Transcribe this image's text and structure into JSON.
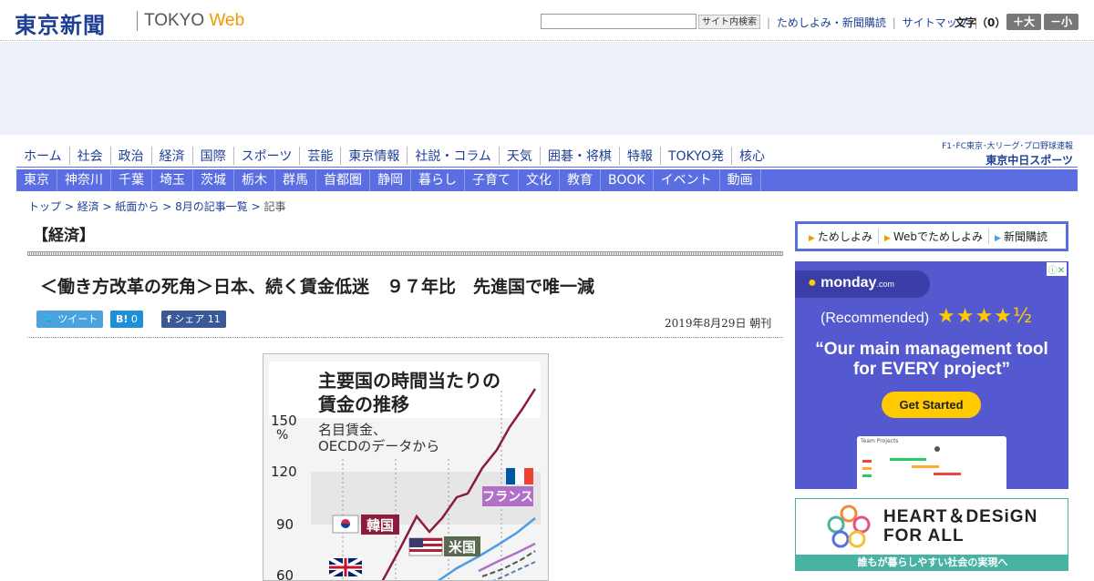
{
  "header": {
    "logo": "東京新聞",
    "logo_en": "TOKYO",
    "logo_web": "Web",
    "search_button": "サイト内検索",
    "search_placeholder": "",
    "links": [
      "ためしよみ・新聞購読",
      "サイトマップ"
    ],
    "fontsize_label": "文字（0）",
    "font_bigger": "＋大",
    "font_smaller": "－小"
  },
  "global_nav": [
    "ホーム",
    "社会",
    "政治",
    "経済",
    "国際",
    "スポーツ",
    "芸能",
    "東京情報",
    "社説・コラム",
    "天気",
    "囲碁・将棋",
    "特報",
    "TOKYO発",
    "核心"
  ],
  "chunichi": {
    "small": "F1･FC東京･大リーグ･プロ野球速報",
    "big": "東京中日スポーツ"
  },
  "sub_nav": [
    "東京",
    "神奈川",
    "千葉",
    "埼玉",
    "茨城",
    "栃木",
    "群馬",
    "首都圏",
    "静岡",
    "暮らし",
    "子育て",
    "文化",
    "教育",
    "BOOK",
    "イベント",
    "動画"
  ],
  "breadcrumb": {
    "items": [
      "トップ",
      "経済",
      "紙面から",
      "8月の記事一覧"
    ],
    "current": "記事"
  },
  "section_title": "【経済】",
  "article": {
    "title": "＜働き方改革の死角＞日本、続く賃金低迷　９７年比　先進国で唯一減",
    "date": "2019年8月29日 朝刊"
  },
  "sns": {
    "tweet": "ツイート",
    "hatena": "B!",
    "hatena_count": "0",
    "facebook": "シェア",
    "facebook_count": "11"
  },
  "figure": {
    "title_line1": "主要国の時間当たりの",
    "title_line2": "賃金の推移",
    "sub_line1": "名目賃金、",
    "sub_line2": "OECDのデータから",
    "y_unit": "%",
    "y_ticks": [
      "150",
      "120",
      "90",
      "60"
    ],
    "labels": {
      "korea": "韓国",
      "usa": "米国",
      "france": "フランス"
    },
    "colors": {
      "korea": "#8b1c3c",
      "usa": "#4d9de0",
      "france": "#b070c8",
      "usa_label_bg": "#5a6a50"
    }
  },
  "sidebar": {
    "tabs": [
      "ためしよみ",
      "Webでためしよみ",
      "新聞購読"
    ]
  },
  "ad_monday": {
    "brand": "monday",
    "brand_suffix": ".com",
    "recommended": "(Recommended)",
    "headline_line1": "“Our main management tool",
    "headline_line2": "for EVERY project”",
    "cta": "Get Started",
    "screenshot_label": "Team Projects",
    "rating": "★★★★½"
  },
  "ad_heart": {
    "title_line1": "HEART＆DESiGN",
    "title_line2": "FOR ALL",
    "tagline": "誰もが暮らしやすい社会の実現へ"
  }
}
